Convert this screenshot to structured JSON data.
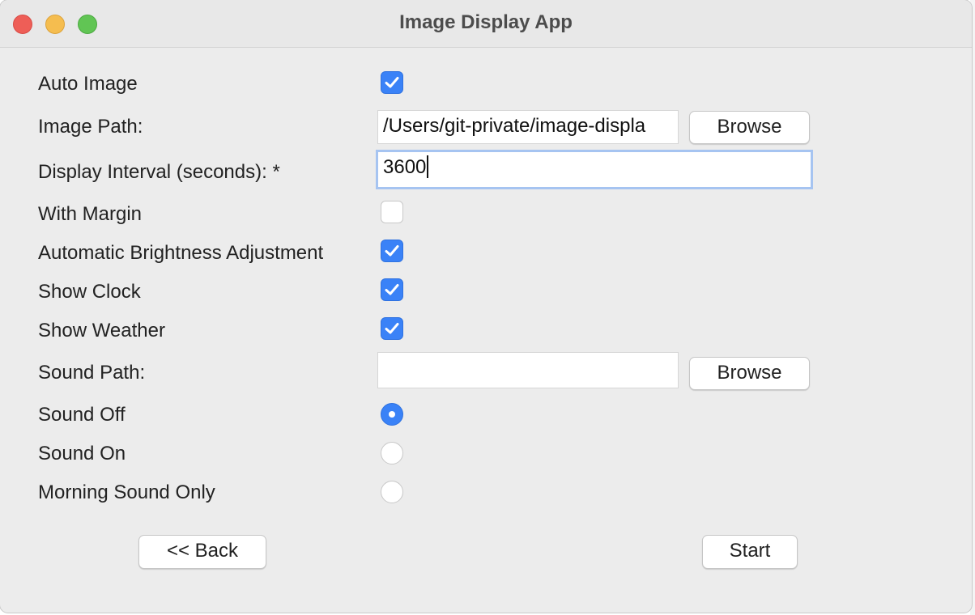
{
  "window": {
    "title": "Image Display App"
  },
  "form": {
    "auto_image": {
      "label": "Auto Image",
      "checked": true
    },
    "image_path": {
      "label": "Image Path:",
      "value": "/Users/git-private/image-displa",
      "browse_label": "Browse"
    },
    "display_interval": {
      "label": "Display Interval (seconds): *",
      "value": "3600"
    },
    "with_margin": {
      "label": "With Margin",
      "checked": false
    },
    "brightness": {
      "label": "Automatic Brightness Adjustment",
      "checked": true
    },
    "show_clock": {
      "label": "Show Clock",
      "checked": true
    },
    "show_weather": {
      "label": "Show Weather",
      "checked": true
    },
    "sound_path": {
      "label": "Sound Path:",
      "value": "",
      "browse_label": "Browse"
    },
    "sound_options": [
      {
        "label": "Sound Off",
        "selected": true
      },
      {
        "label": "Sound On",
        "selected": false
      },
      {
        "label": "Morning Sound Only",
        "selected": false
      }
    ]
  },
  "footer": {
    "back_label": "<< Back",
    "start_label": "Start"
  },
  "colors": {
    "accent": "#3a82f7",
    "window_bg": "#ececec",
    "close": "#ee5e57",
    "minimize": "#f5bd4f",
    "maximize": "#61c554"
  },
  "icons": {
    "checkbox_check": "checkmark-icon",
    "radio_selected": "radio-dot-icon"
  }
}
